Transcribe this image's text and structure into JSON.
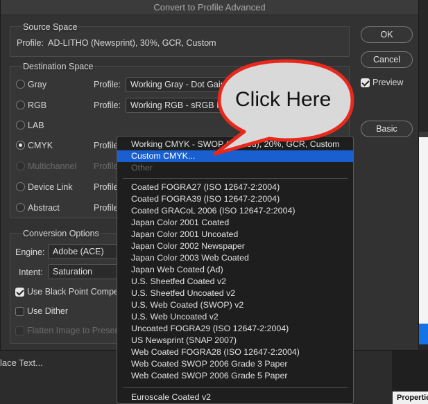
{
  "dialog": {
    "title": "Convert to Profile Advanced",
    "source_space": {
      "heading": "Source Space",
      "profile_text": "Profile:  AD-LITHO (Newsprint), 30%, GCR, Custom"
    },
    "destination_space": {
      "heading": "Destination Space",
      "options": [
        {
          "label": "Gray",
          "selected": false,
          "enabled": true
        },
        {
          "label": "RGB",
          "selected": false,
          "enabled": true
        },
        {
          "label": "LAB",
          "selected": false,
          "enabled": true
        },
        {
          "label": "CMYK",
          "selected": true,
          "enabled": true
        },
        {
          "label": "Multichannel",
          "selected": false,
          "enabled": false
        },
        {
          "label": "Device Link",
          "selected": false,
          "enabled": true
        },
        {
          "label": "Abstract",
          "selected": false,
          "enabled": true
        }
      ],
      "profile_label": "Profile:",
      "gray_profile": "Working Gray - Dot Gain 20%",
      "rgb_profile": "Working RGB - sRGB IEC61966-2.1"
    },
    "conversion_options": {
      "heading": "Conversion Options",
      "engine_label": "Engine:",
      "engine_value": "Adobe (ACE)",
      "intent_label": "Intent:",
      "intent_value": "Saturation",
      "black_point_label": "Use Black Point Compensation",
      "black_point_checked": true,
      "dither_label": "Use Dither",
      "dither_checked": false,
      "flatten_label": "Flatten Image to Preserve Appearance",
      "flatten_checked": false
    },
    "buttons": {
      "ok": "OK",
      "cancel": "Cancel",
      "preview": "Preview",
      "preview_checked": true,
      "basic": "Basic"
    }
  },
  "dropdown": {
    "current": "Working CMYK - SWOP (Coated), 20%, GCR, Custom",
    "highlighted": "Custom CMYK...",
    "other": "Other",
    "profiles": [
      "Coated FOGRA27 (ISO 12647-2:2004)",
      "Coated FOGRA39 (ISO 12647-2:2004)",
      "Coated GRACoL 2006 (ISO 12647-2:2004)",
      "Japan Color 2001 Coated",
      "Japan Color 2001 Uncoated",
      "Japan Color 2002 Newspaper",
      "Japan Color 2003 Web Coated",
      "Japan Web Coated (Ad)",
      "U.S. Sheetfed Coated v2",
      "U.S. Sheetfed Uncoated v2",
      "U.S. Web Coated (SWOP) v2",
      "U.S. Web Uncoated v2",
      "Uncoated FOGRA29 (ISO 12647-2:2004)",
      "US Newsprint (SNAP 2007)",
      "Web Coated FOGRA28 (ISO 12647-2:2004)",
      "Web Coated SWOP 2006 Grade 3 Paper",
      "Web Coated SWOP 2006 Grade 5 Paper"
    ],
    "last_item": "Euroscale Coated v2"
  },
  "callout": {
    "text": "Click Here",
    "border_color": "#e8281c",
    "fill_color": "#d9d9d9"
  },
  "background": {
    "text": "lace Text...",
    "properties_tab": "Propertie",
    "accent_color": "#1473e6"
  }
}
